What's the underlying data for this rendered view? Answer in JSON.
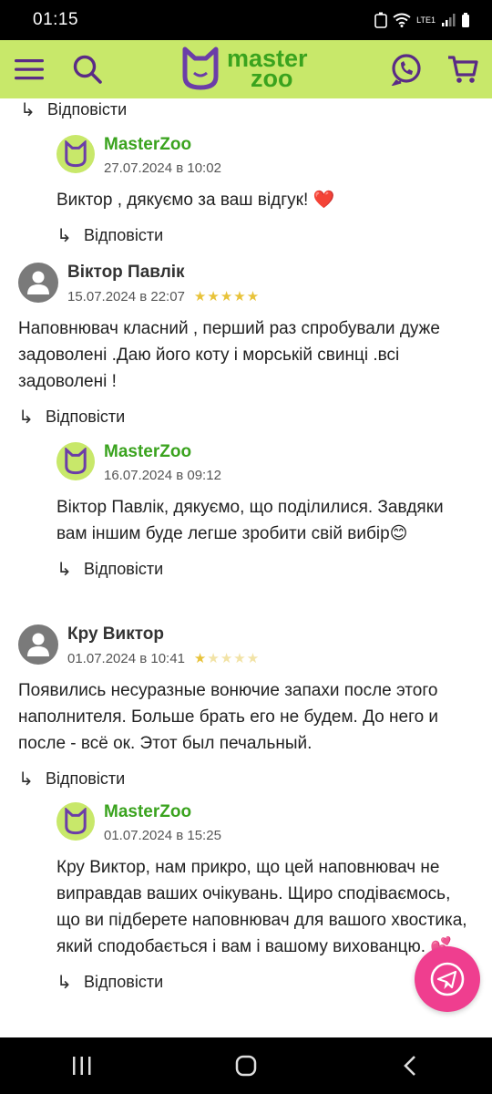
{
  "status": {
    "time": "01:15",
    "network": "LTE1"
  },
  "header": {
    "logo_line1": "master",
    "logo_line2": "zoo",
    "accent": "#c8e86a",
    "brand_green": "#3aa31e"
  },
  "reply_label": "Відповісти",
  "top_reply": {
    "label": "Відповісти"
  },
  "answers": [
    {
      "author": "MasterZoo",
      "date": "27.07.2024 в 10:02",
      "text": "Виктор , дякуємо за ваш відгук! ❤️",
      "reply": "Відповісти"
    },
    {
      "author": "MasterZoo",
      "date": "16.07.2024 в 09:12",
      "text": "Віктор Павлік, дякуємо, що поділилися. Завдяки вам іншим буде легше зробити свій вибір😊",
      "reply": "Відповісти"
    },
    {
      "author": "MasterZoo",
      "date": "01.07.2024 в 15:25",
      "text": "Кру Виктор, нам прикро, що цей наповнювач не виправдав ваших очікувань. Щиро сподіваємось, що ви підберете наповнювач для вашого хвостика, який сподобається і вам і вашому вихованцю. 💕",
      "reply": "Відповісти"
    }
  ],
  "reviews": [
    {
      "author": "Віктор Павлік",
      "date": "15.07.2024 в 22:07",
      "rating": 5,
      "text": "Наповнювач класний , перший раз спробували дуже задоволені .Даю його коту і морській свинці .всі задоволені !",
      "reply": "Відповісти"
    },
    {
      "author": "Кру Виктор",
      "date": "01.07.2024 в 10:41",
      "rating": 1,
      "text": "Появились несуразные вонючие запахи после этого наполнителя. Больше брать его не будем. До него и после - всё ок. Этот был печальный.",
      "reply": "Відповісти"
    }
  ],
  "fab": {
    "icon": "telegram-icon",
    "color": "#ef3e8f"
  }
}
